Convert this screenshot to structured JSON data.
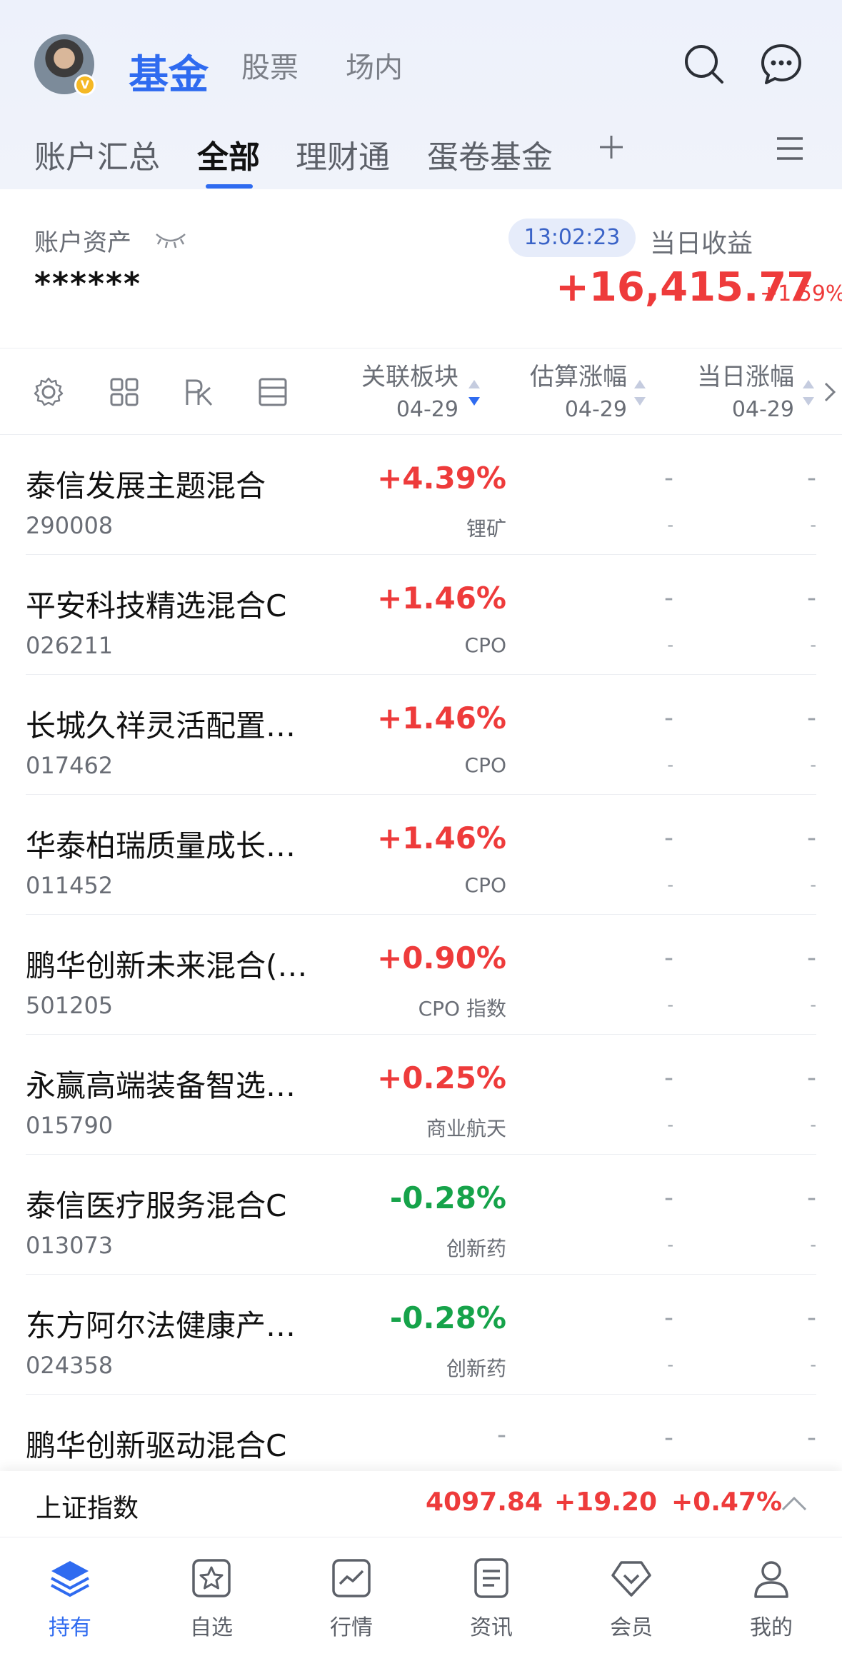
{
  "header": {
    "tabs": [
      "基金",
      "股票",
      "场内"
    ],
    "active_tab": "基金"
  },
  "subtabs": [
    "账户汇总",
    "全部",
    "理财通",
    "蛋卷基金"
  ],
  "account": {
    "asset_label": "账户资产",
    "asset_value": "******",
    "time": "13:02:23",
    "today_label": "当日收益",
    "today_value": "+16,415.77",
    "today_pct": "+1.59%"
  },
  "columns": [
    {
      "title": "关联板块",
      "date": "04-29"
    },
    {
      "title": "估算涨幅",
      "date": "04-29"
    },
    {
      "title": "当日涨幅",
      "date": "04-29"
    }
  ],
  "funds": [
    {
      "name": "泰信发展主题混合",
      "code": "290008",
      "pct": "+4.39%",
      "sector": "锂矿",
      "dir": "up"
    },
    {
      "name": "平安科技精选混合C",
      "code": "026211",
      "pct": "+1.46%",
      "sector": "CPO",
      "dir": "up"
    },
    {
      "name": "长城久祥灵活配置…",
      "code": "017462",
      "pct": "+1.46%",
      "sector": "CPO",
      "dir": "up"
    },
    {
      "name": "华泰柏瑞质量成长…",
      "code": "011452",
      "pct": "+1.46%",
      "sector": "CPO",
      "dir": "up"
    },
    {
      "name": "鹏华创新未来混合(…",
      "code": "501205",
      "pct": "+0.90%",
      "sector": "CPO 指数",
      "dir": "up"
    },
    {
      "name": "永赢高端装备智选…",
      "code": "015790",
      "pct": "+0.25%",
      "sector": "商业航天",
      "dir": "up"
    },
    {
      "name": "泰信医疗服务混合C",
      "code": "013073",
      "pct": "-0.28%",
      "sector": "创新药",
      "dir": "down"
    },
    {
      "name": "东方阿尔法健康产…",
      "code": "024358",
      "pct": "-0.28%",
      "sector": "创新药",
      "dir": "down"
    },
    {
      "name": "鹏华创新驱动混合C",
      "code": "",
      "pct": "-",
      "sector": "",
      "dir": "none"
    }
  ],
  "dash": "-",
  "index": {
    "name": "上证指数",
    "value": "4097.84",
    "change": "+19.20",
    "pct": "+0.47%"
  },
  "nav": [
    "持有",
    "自选",
    "行情",
    "资讯",
    "会员",
    "我的"
  ],
  "icons": {
    "search": "search-icon",
    "message": "message-icon",
    "plus": "plus-icon",
    "menu": "menu-icon",
    "eye": "eye-closed-icon",
    "settings": "gear-icon",
    "grid": "grid-icon",
    "pk": "pk-icon",
    "list": "list-icon"
  },
  "colors": {
    "accent": "#2f6bf0",
    "up": "#ee3b3b",
    "down": "#16a34a"
  }
}
